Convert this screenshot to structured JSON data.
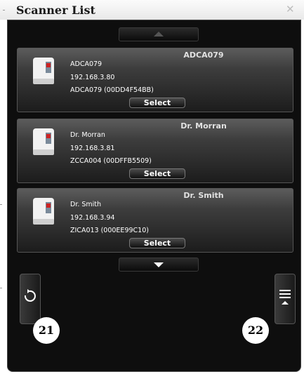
{
  "window": {
    "title": "Scanner List",
    "close_icon": "close-x-icon"
  },
  "navigation": {
    "scroll_up_icon": "triangle-up-icon",
    "scroll_down_icon": "triangle-down-icon"
  },
  "scanners": [
    {
      "heading": "ADCA079",
      "name": "ADCA079",
      "ip": "192.168.3.80",
      "model": "ADCA079 (00DD4F54BB)",
      "button": "Select"
    },
    {
      "heading": "Dr. Morran",
      "name": "Dr. Morran",
      "ip": "192.168.3.81",
      "model": "ZCCA004 (00DFFB5509)",
      "button": "Select"
    },
    {
      "heading": "Dr. Smith",
      "name": "Dr. Smith",
      "ip": "192.168.3.94",
      "model": "ZICA013 (000EE99C10)",
      "button": "Select"
    }
  ],
  "footer": {
    "refresh_icon": "refresh-icon",
    "menu_icon": "menu-icon",
    "callout_left": "21",
    "callout_right": "22"
  },
  "colors": {
    "panel_background": "#0e0e0e",
    "card_text": "#ffffff",
    "card_heading": "#e2e2e2"
  }
}
